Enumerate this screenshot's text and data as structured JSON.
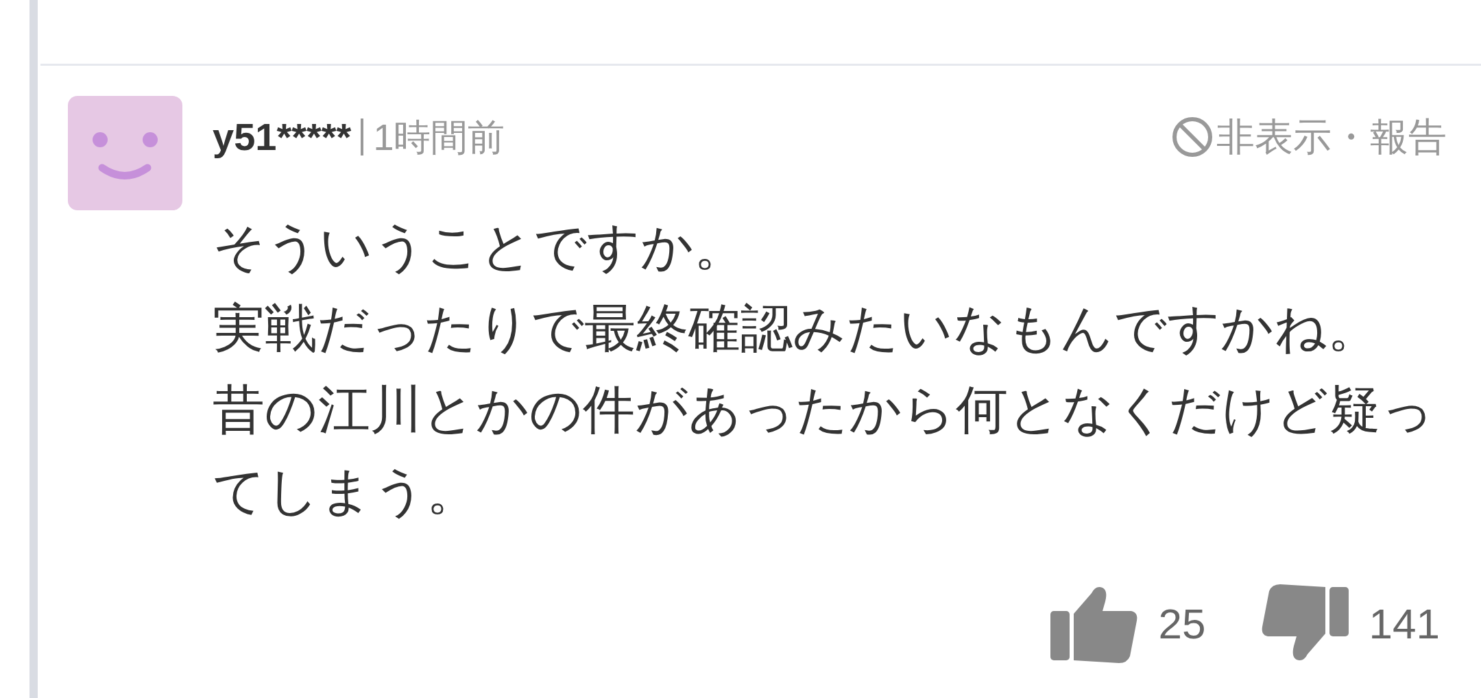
{
  "comment": {
    "user": "y51*****",
    "time": "1時間前",
    "hide_report": "非表示・報告",
    "lines": [
      "そういうことですか。",
      "実戦だったりで最終確認みたいなもんですかね。",
      "昔の江川とかの件があったから何となくだけど疑ってしまう。"
    ],
    "likes": "25",
    "dislikes": "141"
  }
}
